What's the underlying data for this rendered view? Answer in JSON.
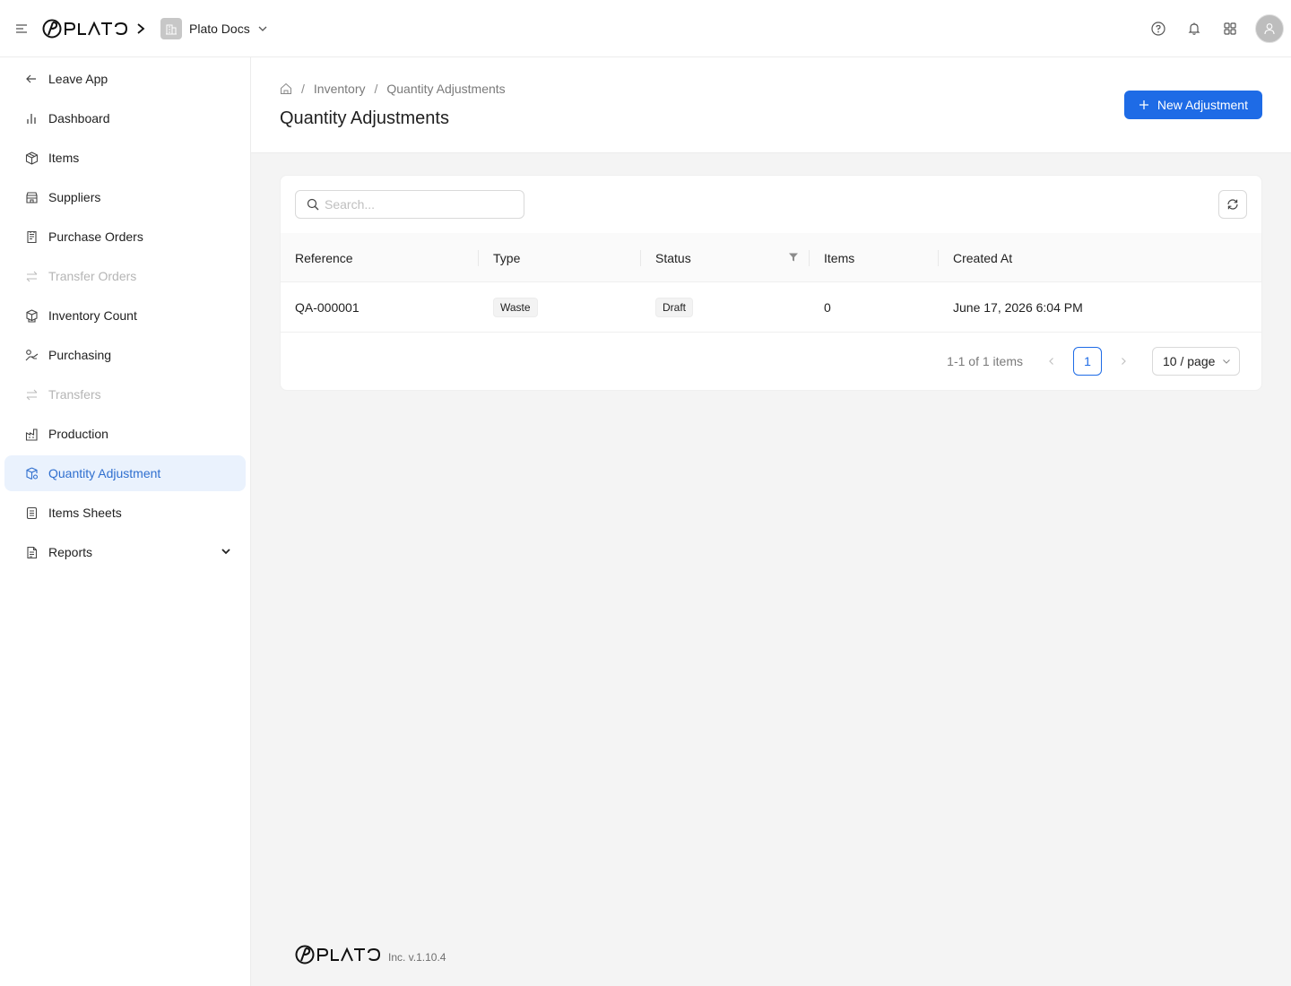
{
  "topbar": {
    "brand": "PLATO",
    "org_name": "Plato Docs"
  },
  "sidebar": {
    "items": [
      {
        "label": "Leave App",
        "icon": "arrow-left-icon"
      },
      {
        "label": "Dashboard",
        "icon": "bar-chart-icon"
      },
      {
        "label": "Items",
        "icon": "cube-icon"
      },
      {
        "label": "Suppliers",
        "icon": "store-icon"
      },
      {
        "label": "Purchase Orders",
        "icon": "receipt-icon"
      },
      {
        "label": "Transfer Orders",
        "icon": "transfer-icon",
        "disabled": true
      },
      {
        "label": "Inventory Count",
        "icon": "boxes-icon"
      },
      {
        "label": "Purchasing",
        "icon": "purchasing-icon"
      },
      {
        "label": "Transfers",
        "icon": "transfer-icon",
        "disabled": true
      },
      {
        "label": "Production",
        "icon": "factory-icon"
      },
      {
        "label": "Quantity Adjustment",
        "icon": "cube-settings-icon",
        "active": true
      },
      {
        "label": "Items Sheets",
        "icon": "sheet-icon"
      },
      {
        "label": "Reports",
        "icon": "report-icon",
        "expandable": true
      }
    ]
  },
  "breadcrumb": {
    "items": [
      "Inventory",
      "Quantity Adjustments"
    ]
  },
  "page": {
    "title": "Quantity Adjustments",
    "new_button": "New Adjustment"
  },
  "search": {
    "placeholder": "Search..."
  },
  "table": {
    "columns": [
      "Reference",
      "Type",
      "Status",
      "Items",
      "Created At"
    ],
    "rows": [
      {
        "reference": "QA-000001",
        "type": "Waste",
        "status": "Draft",
        "items": "0",
        "created_at": "June 17, 2026 6:04 PM"
      }
    ]
  },
  "pagination": {
    "total": "1-1 of 1 items",
    "current_page": "1",
    "page_size": "10 / page"
  },
  "footer": {
    "brand": "PLATO",
    "text": "Inc. v.1.10.4"
  },
  "colors": {
    "primary": "#1e6be6",
    "active_bg": "#eaf2fd",
    "active_text": "#2f6fcf"
  }
}
